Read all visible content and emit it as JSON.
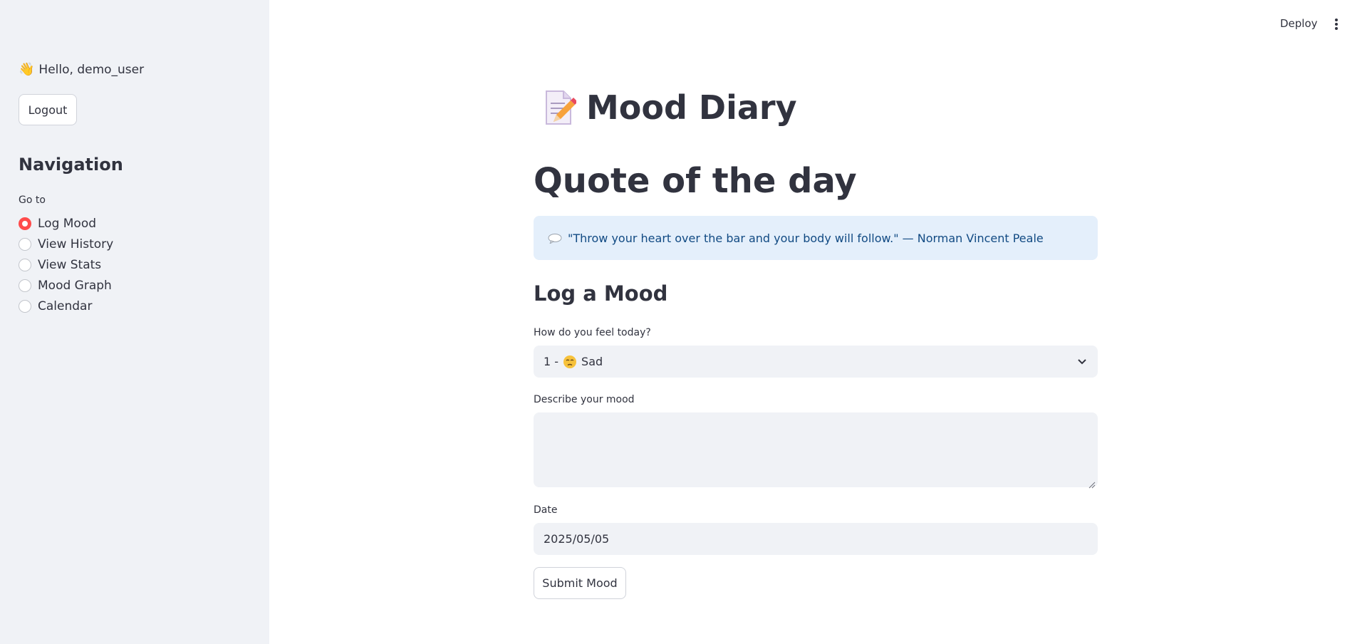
{
  "sidebar": {
    "greeting_icon": "waving-hand-icon",
    "greeting": "Hello, demo_user",
    "logout_label": "Logout",
    "nav_title": "Navigation",
    "goto_label": "Go to",
    "items": [
      {
        "label": "Log Mood",
        "selected": true
      },
      {
        "label": "View History",
        "selected": false
      },
      {
        "label": "View Stats",
        "selected": false
      },
      {
        "label": "Mood Graph",
        "selected": false
      },
      {
        "label": "Calendar",
        "selected": false
      }
    ]
  },
  "header": {
    "deploy_label": "Deploy",
    "menu_icon": "kebab-menu-icon"
  },
  "main": {
    "title_icon": "memo-icon",
    "title": "Mood Diary",
    "quote_heading": "Quote of the day",
    "quote_icon": "speech-balloon-icon",
    "quote_text": "\"Throw your heart over the bar and your body will follow.\" — Norman Vincent Peale",
    "log_heading": "Log a Mood",
    "mood_label": "How do you feel today?",
    "mood_value_prefix": "1 -",
    "mood_value_icon": "sad-face-icon",
    "mood_value_text": "Sad",
    "describe_label": "Describe your mood",
    "describe_value": "",
    "date_label": "Date",
    "date_value": "2025/05/05",
    "submit_label": "Submit Mood"
  },
  "colors": {
    "sidebar_bg": "#f0f2f6",
    "accent": "#ff4b4b",
    "info_bg": "#e4effb",
    "info_text": "#114a83",
    "text": "#31333f"
  }
}
